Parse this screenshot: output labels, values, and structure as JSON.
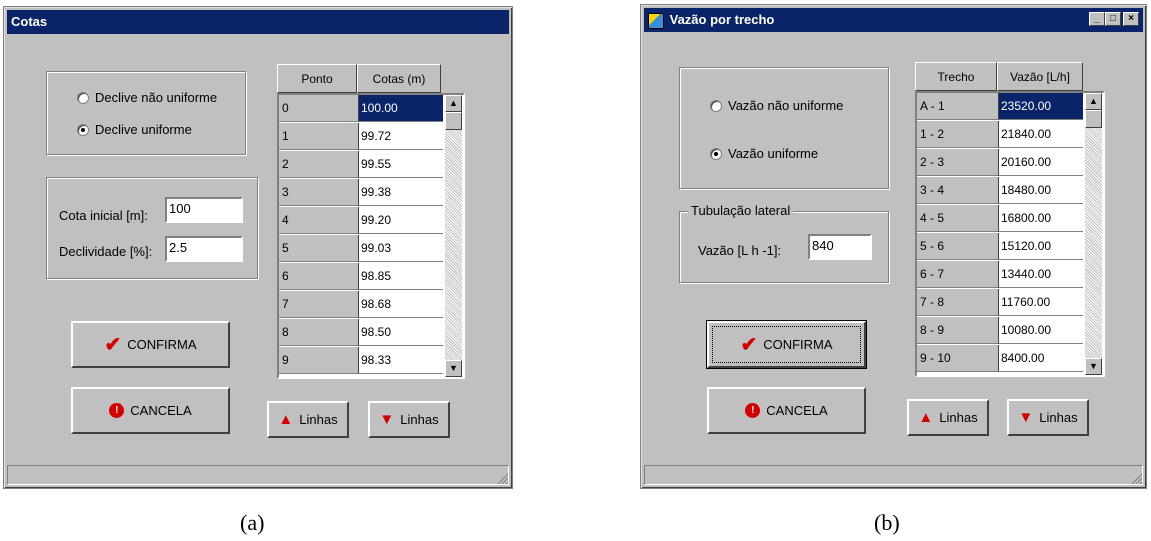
{
  "window_a": {
    "title": "Cotas",
    "radio_options": [
      {
        "label": "Declive não uniforme",
        "selected": false
      },
      {
        "label": "Declive uniforme",
        "selected": true
      }
    ],
    "fields": [
      {
        "label": "Cota inicial [m]:",
        "value": "100"
      },
      {
        "label": "Declividade [%]:",
        "value": "2.5"
      }
    ],
    "grid": {
      "headers": [
        "Ponto",
        "Cotas (m)"
      ],
      "rows": [
        [
          "0",
          "100.00"
        ],
        [
          "1",
          "99.72"
        ],
        [
          "2",
          "99.55"
        ],
        [
          "3",
          "99.38"
        ],
        [
          "4",
          "99.20"
        ],
        [
          "5",
          "99.03"
        ],
        [
          "6",
          "98.85"
        ],
        [
          "7",
          "98.68"
        ],
        [
          "8",
          "98.50"
        ],
        [
          "9",
          "98.33"
        ]
      ],
      "selected_row": 0
    },
    "confirm_label": "CONFIRMA",
    "cancel_label": "CANCELA",
    "add_rows_label": "Linhas",
    "remove_rows_label": "Linhas"
  },
  "window_b": {
    "title": "Vazão por trecho",
    "radio_options": [
      {
        "label": "Vazão não uniforme",
        "selected": false
      },
      {
        "label": "Vazão uniforme",
        "selected": true
      }
    ],
    "group_label": "Tubulação lateral",
    "fields": [
      {
        "label": "Vazão [L h -1]:",
        "value": "840"
      }
    ],
    "grid": {
      "headers": [
        "Trecho",
        "Vazão [L/h]"
      ],
      "rows": [
        [
          "A - 1",
          "23520.00"
        ],
        [
          "1 - 2",
          "21840.00"
        ],
        [
          "2 - 3",
          "20160.00"
        ],
        [
          "3 - 4",
          "18480.00"
        ],
        [
          "4 - 5",
          "16800.00"
        ],
        [
          "5 - 6",
          "15120.00"
        ],
        [
          "6 - 7",
          "13440.00"
        ],
        [
          "7 - 8",
          "11760.00"
        ],
        [
          "8 - 9",
          "10080.00"
        ],
        [
          "9 - 10",
          "8400.00"
        ]
      ],
      "selected_row": 0
    },
    "confirm_label": "CONFIRMA",
    "cancel_label": "CANCELA",
    "add_rows_label": "Linhas",
    "remove_rows_label": "Linhas"
  },
  "captions": [
    "(a)",
    "(b)"
  ],
  "colors": {
    "titlebar": "#0a246a",
    "window_bg": "#c0c0c0",
    "icon_red": "#d40000"
  }
}
